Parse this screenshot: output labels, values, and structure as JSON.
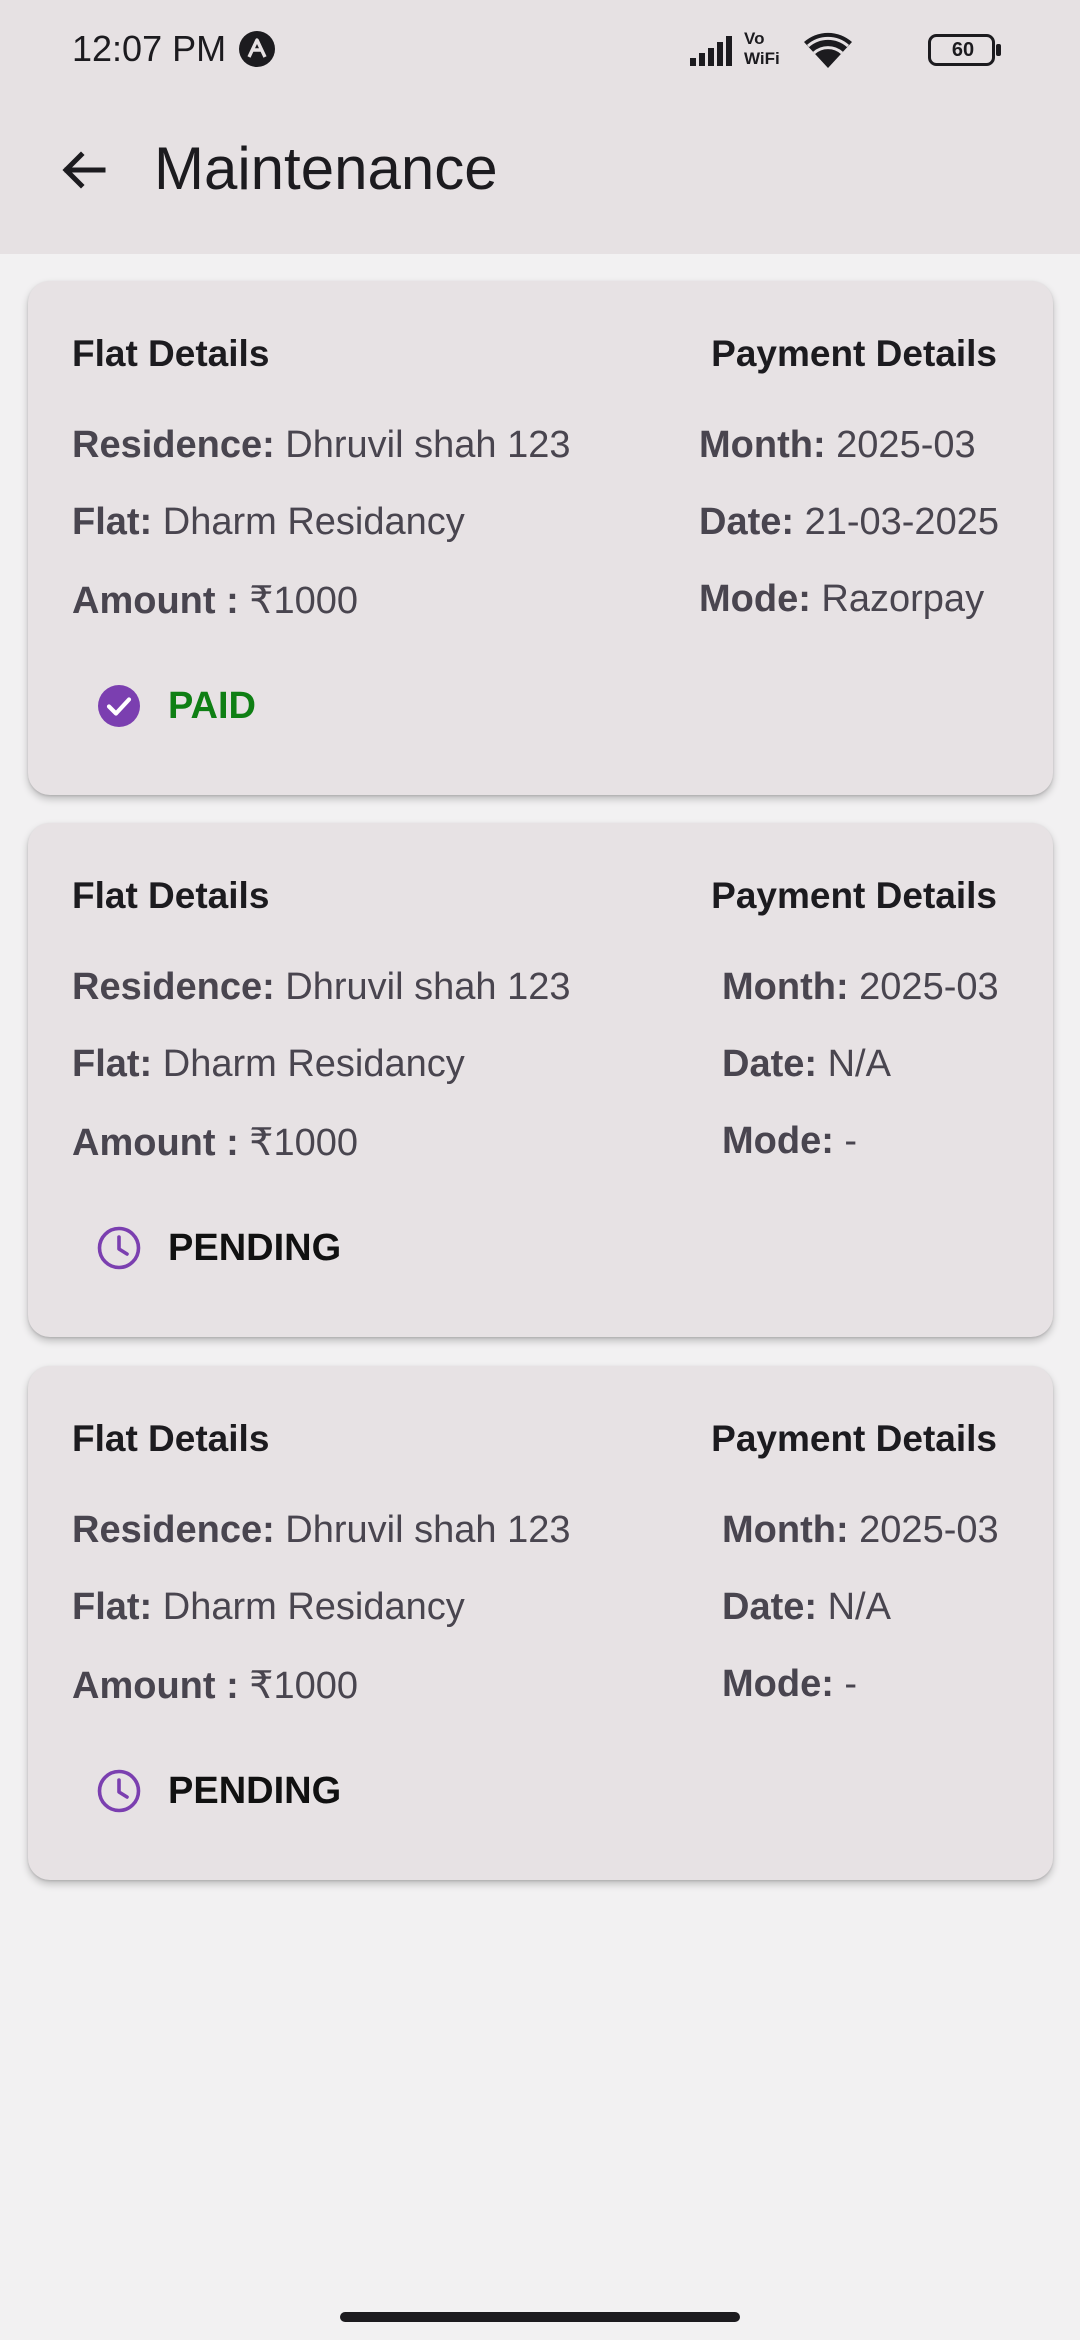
{
  "status_bar": {
    "time": "12:07 PM",
    "notification_icon": "a-circle-icon",
    "network_label": "Vo WiFi",
    "network_top": "Vo",
    "network_bottom": "WiFi",
    "battery": "60"
  },
  "app_bar": {
    "title": "Maintenance",
    "back_icon": "arrow-back-icon"
  },
  "cards": [
    {
      "flat_title": "Flat Details",
      "payment_title": "Payment Details",
      "residence_label": "Residence:",
      "residence_value": " Dhruvil shah 123",
      "flat_label": "Flat:",
      "flat_value": " Dharm Residancy",
      "amount_label": "Amount :",
      "amount_value": " ₹1000",
      "month_label": "Month:",
      "month_value": " 2025-03",
      "date_label": "Date:",
      "date_value": " 21-03-2025",
      "mode_label": "Mode:",
      "mode_value": " Razorpay",
      "status": "PAID",
      "status_icon": "check-circle-icon"
    },
    {
      "flat_title": "Flat Details",
      "payment_title": "Payment Details",
      "residence_label": "Residence:",
      "residence_value": " Dhruvil shah 123",
      "flat_label": "Flat:",
      "flat_value": " Dharm Residancy",
      "amount_label": "Amount :",
      "amount_value": " ₹1000",
      "month_label": "Month:",
      "month_value": " 2025-03",
      "date_label": "Date:",
      "date_value": " N/A",
      "mode_label": "Mode:",
      "mode_value": " -",
      "status": "PENDING",
      "status_icon": "clock-icon"
    },
    {
      "flat_title": "Flat Details",
      "payment_title": "Payment Details",
      "residence_label": "Residence:",
      "residence_value": " Dhruvil shah 123",
      "flat_label": "Flat:",
      "flat_value": " Dharm Residancy",
      "amount_label": "Amount :",
      "amount_value": " ₹1000",
      "month_label": "Month:",
      "month_value": " 2025-03",
      "date_label": "Date:",
      "date_value": " N/A",
      "mode_label": "Mode:",
      "mode_value": " -",
      "status": "PENDING",
      "status_icon": "clock-icon"
    }
  ],
  "colors": {
    "app_bar": "#e6e1e3",
    "card": "#e7e2e4",
    "background": "#f2f1f2",
    "paid": "#0f7f14",
    "icon_purple": "#7b3fb0"
  }
}
